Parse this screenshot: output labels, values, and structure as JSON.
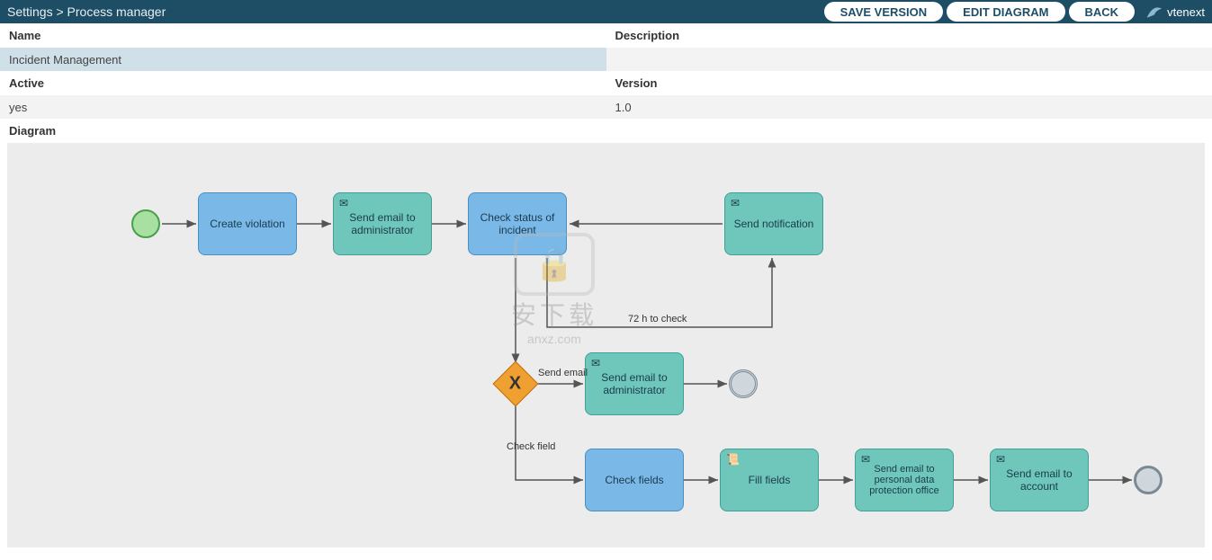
{
  "breadcrumb": "Settings > Process manager",
  "buttons": {
    "save": "SAVE VERSION",
    "edit": "EDIT DIAGRAM",
    "back": "BACK"
  },
  "logo_text": "vtenext",
  "fields": {
    "name_label": "Name",
    "name_value": "Incident Management",
    "description_label": "Description",
    "description_value": "",
    "active_label": "Active",
    "active_value": "yes",
    "version_label": "Version",
    "version_value": "1.0",
    "diagram_label": "Diagram"
  },
  "diagram": {
    "start": "Start",
    "tasks": {
      "create_violation": "Create violation",
      "send_admin_1": "Send email to administrator",
      "check_status": "Check status of incident",
      "send_notification": "Send notification",
      "send_admin_2": "Send email to administrator",
      "check_fields": "Check fields",
      "fill_fields": "Fill fields",
      "send_dpo": "Send email to personal data protection office",
      "send_account": "Send email to account"
    },
    "gateway_symbol": "X",
    "edge_labels": {
      "timer": "72 h to check",
      "send_email": "Send email",
      "check_field": "Check field"
    }
  },
  "watermark": {
    "chinese": "安下载",
    "domain": "anxz.com"
  }
}
